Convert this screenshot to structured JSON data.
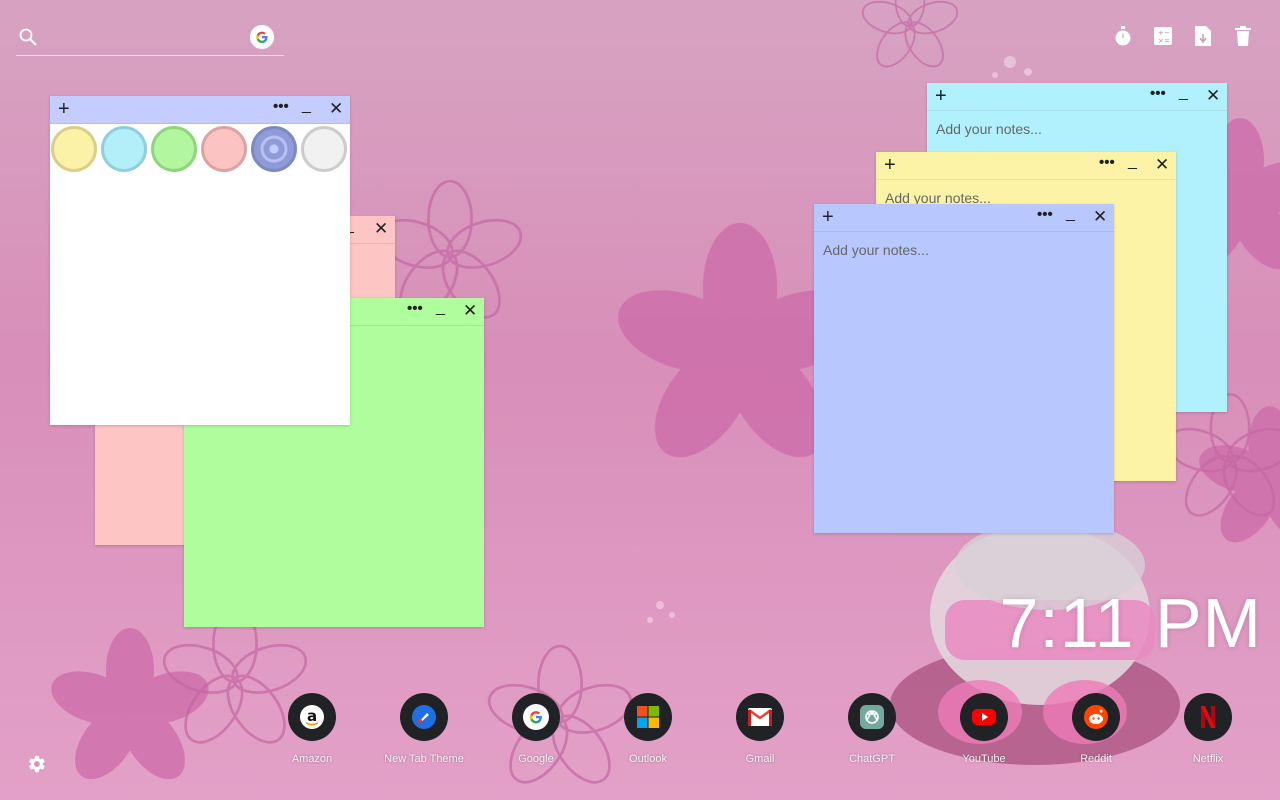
{
  "search": {
    "placeholder": "",
    "engine_icon": "google-icon"
  },
  "tools": [
    {
      "name": "timer-icon"
    },
    {
      "name": "calculator-icon"
    },
    {
      "name": "notes-icon"
    },
    {
      "name": "trash-icon"
    }
  ],
  "notes": {
    "color_picker": {
      "swatch_colors": [
        "#fbf1a7",
        "#b3eff9",
        "#b2f7a0",
        "#fcc3c3",
        "#8f9bd8",
        "#f1f1f1"
      ]
    },
    "pink": {
      "color": "#fdc5c4"
    },
    "green": {
      "color": "#b0fd9d"
    },
    "cyan": {
      "color": "#b1f1fd",
      "placeholder": "Add your notes..."
    },
    "yellow": {
      "color": "#fdf3a6",
      "placeholder": "Add your notes..."
    },
    "blue": {
      "color": "#b8c7fd",
      "placeholder": "Add your notes..."
    },
    "plus_symbol": "+",
    "menu_symbol": "•••",
    "minimize_symbol": "_",
    "close_symbol": "✕"
  },
  "clock": {
    "time": "7:11 PM"
  },
  "dock": {
    "apps": [
      {
        "label": "Amazon",
        "icon": "amazon-icon"
      },
      {
        "label": "New Tab Theme",
        "icon": "new-tab-theme-icon"
      },
      {
        "label": "Google",
        "icon": "google-icon"
      },
      {
        "label": "Outlook",
        "icon": "microsoft-icon"
      },
      {
        "label": "Gmail",
        "icon": "gmail-icon"
      },
      {
        "label": "ChatGPT",
        "icon": "chatgpt-icon"
      },
      {
        "label": "YouTube",
        "icon": "youtube-icon"
      },
      {
        "label": "Reddit",
        "icon": "reddit-icon"
      },
      {
        "label": "Netflix",
        "icon": "netflix-icon"
      }
    ]
  },
  "settings": {
    "icon": "gear-icon"
  }
}
